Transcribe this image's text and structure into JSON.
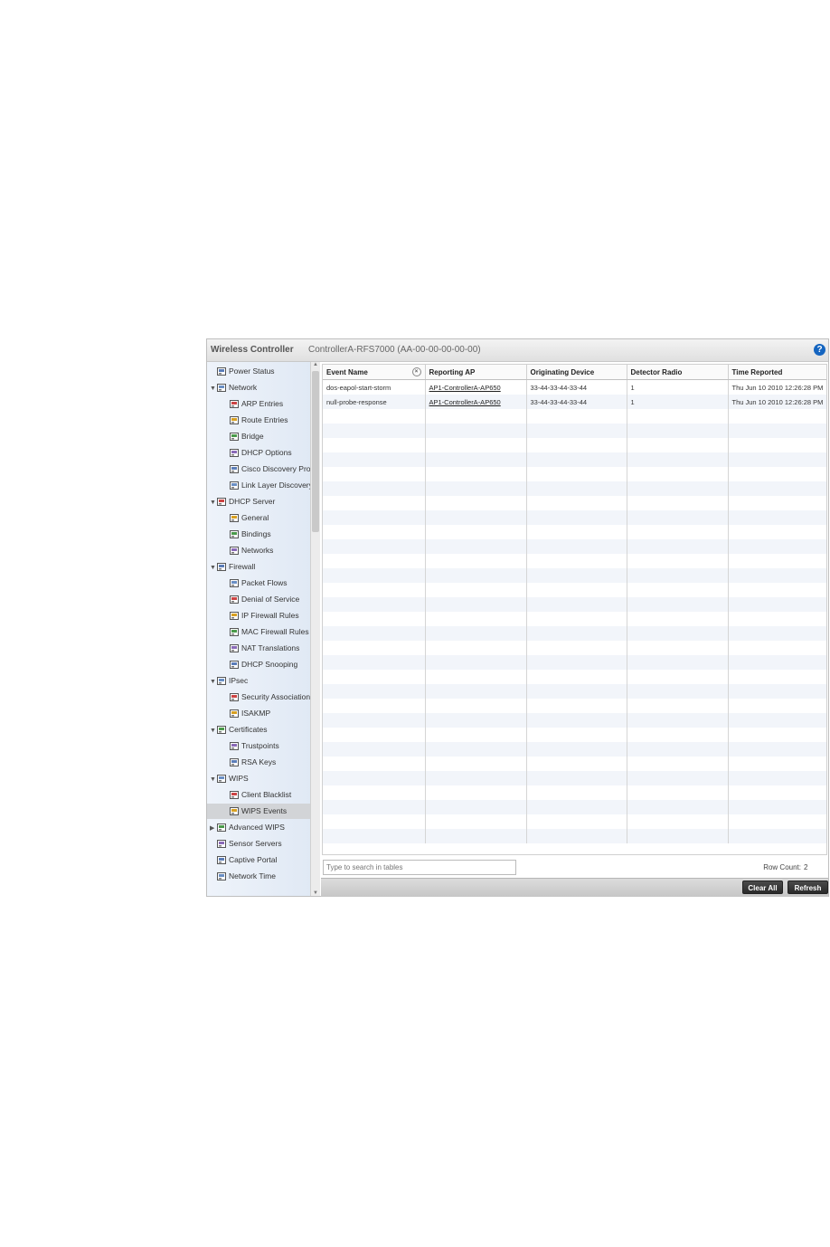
{
  "header": {
    "title": "Wireless Controller",
    "device": "ControllerA-RFS7000 (AA-00-00-00-00-00)",
    "help_label": "?"
  },
  "sidebar": {
    "items": [
      {
        "label": "Power Status",
        "icon": "power-status-icon",
        "indent": 0,
        "arrow": ""
      },
      {
        "label": "Network",
        "icon": "network-icon",
        "indent": 0,
        "arrow": "▼"
      },
      {
        "label": "ARP Entries",
        "icon": "arp-entries-icon",
        "indent": 1,
        "arrow": ""
      },
      {
        "label": "Route Entries",
        "icon": "route-entries-icon",
        "indent": 1,
        "arrow": ""
      },
      {
        "label": "Bridge",
        "icon": "bridge-icon",
        "indent": 1,
        "arrow": ""
      },
      {
        "label": "DHCP Options",
        "icon": "dhcp-options-icon",
        "indent": 1,
        "arrow": ""
      },
      {
        "label": "Cisco Discovery Prot",
        "icon": "cdp-icon",
        "indent": 1,
        "arrow": ""
      },
      {
        "label": "Link Layer Discovery",
        "icon": "lldp-icon",
        "indent": 1,
        "arrow": ""
      },
      {
        "label": "DHCP Server",
        "icon": "dhcp-server-icon",
        "indent": 0,
        "arrow": "▼"
      },
      {
        "label": "General",
        "icon": "general-icon",
        "indent": 1,
        "arrow": ""
      },
      {
        "label": "Bindings",
        "icon": "bindings-icon",
        "indent": 1,
        "arrow": ""
      },
      {
        "label": "Networks",
        "icon": "networks-icon",
        "indent": 1,
        "arrow": ""
      },
      {
        "label": "Firewall",
        "icon": "firewall-icon",
        "indent": 0,
        "arrow": "▼"
      },
      {
        "label": "Packet Flows",
        "icon": "packet-flows-icon",
        "indent": 1,
        "arrow": ""
      },
      {
        "label": "Denial of Service",
        "icon": "denial-of-service-icon",
        "indent": 1,
        "arrow": ""
      },
      {
        "label": "IP Firewall Rules",
        "icon": "ip-firewall-rules-icon",
        "indent": 1,
        "arrow": ""
      },
      {
        "label": "MAC Firewall Rules",
        "icon": "mac-firewall-rules-icon",
        "indent": 1,
        "arrow": ""
      },
      {
        "label": "NAT Translations",
        "icon": "nat-translations-icon",
        "indent": 1,
        "arrow": ""
      },
      {
        "label": "DHCP Snooping",
        "icon": "dhcp-snooping-icon",
        "indent": 1,
        "arrow": ""
      },
      {
        "label": "IPsec",
        "icon": "ipsec-icon",
        "indent": 0,
        "arrow": "▼"
      },
      {
        "label": "Security Associations",
        "icon": "security-associations-icon",
        "indent": 1,
        "arrow": ""
      },
      {
        "label": "ISAKMP",
        "icon": "isakmp-icon",
        "indent": 1,
        "arrow": ""
      },
      {
        "label": "Certificates",
        "icon": "certificates-icon",
        "indent": 0,
        "arrow": "▼"
      },
      {
        "label": "Trustpoints",
        "icon": "trustpoints-icon",
        "indent": 1,
        "arrow": ""
      },
      {
        "label": "RSA Keys",
        "icon": "rsa-keys-icon",
        "indent": 1,
        "arrow": ""
      },
      {
        "label": "WIPS",
        "icon": "wips-icon",
        "indent": 0,
        "arrow": "▼"
      },
      {
        "label": "Client Blacklist",
        "icon": "client-blacklist-icon",
        "indent": 1,
        "arrow": ""
      },
      {
        "label": "WIPS Events",
        "icon": "wips-events-icon",
        "indent": 1,
        "arrow": "",
        "selected": true
      },
      {
        "label": "Advanced WIPS",
        "icon": "advanced-wips-icon",
        "indent": 0,
        "arrow": "▶"
      },
      {
        "label": "Sensor Servers",
        "icon": "sensor-servers-icon",
        "indent": 0,
        "arrow": ""
      },
      {
        "label": "Captive Portal",
        "icon": "captive-portal-icon",
        "indent": 0,
        "arrow": ""
      },
      {
        "label": "Network Time",
        "icon": "network-time-icon",
        "indent": 0,
        "arrow": ""
      }
    ]
  },
  "table": {
    "columns": [
      "Event Name",
      "Reporting AP",
      "Originating Device",
      "Detector Radio",
      "Time Reported"
    ],
    "rows": [
      [
        "dos-eapol-start-storm",
        "AP1-ControllerA-AP650",
        "33-44-33-44-33-44",
        "1",
        "Thu Jun 10 2010 12:26:28 PM"
      ],
      [
        "null-probe-response",
        "AP1-ControllerA-AP650",
        "33-44-33-44-33-44",
        "1",
        "Thu Jun 10 2010 12:26:28 PM"
      ]
    ]
  },
  "footer": {
    "search_placeholder": "Type to search in tables",
    "row_count_label": "Row Count:",
    "row_count_value": "2",
    "clear_all_label": "Clear All",
    "refresh_label": "Refresh"
  },
  "colors": {
    "accent": "#1565c0",
    "selected_row": "#d2d4d7",
    "alt_row": "#f2f5fa"
  }
}
